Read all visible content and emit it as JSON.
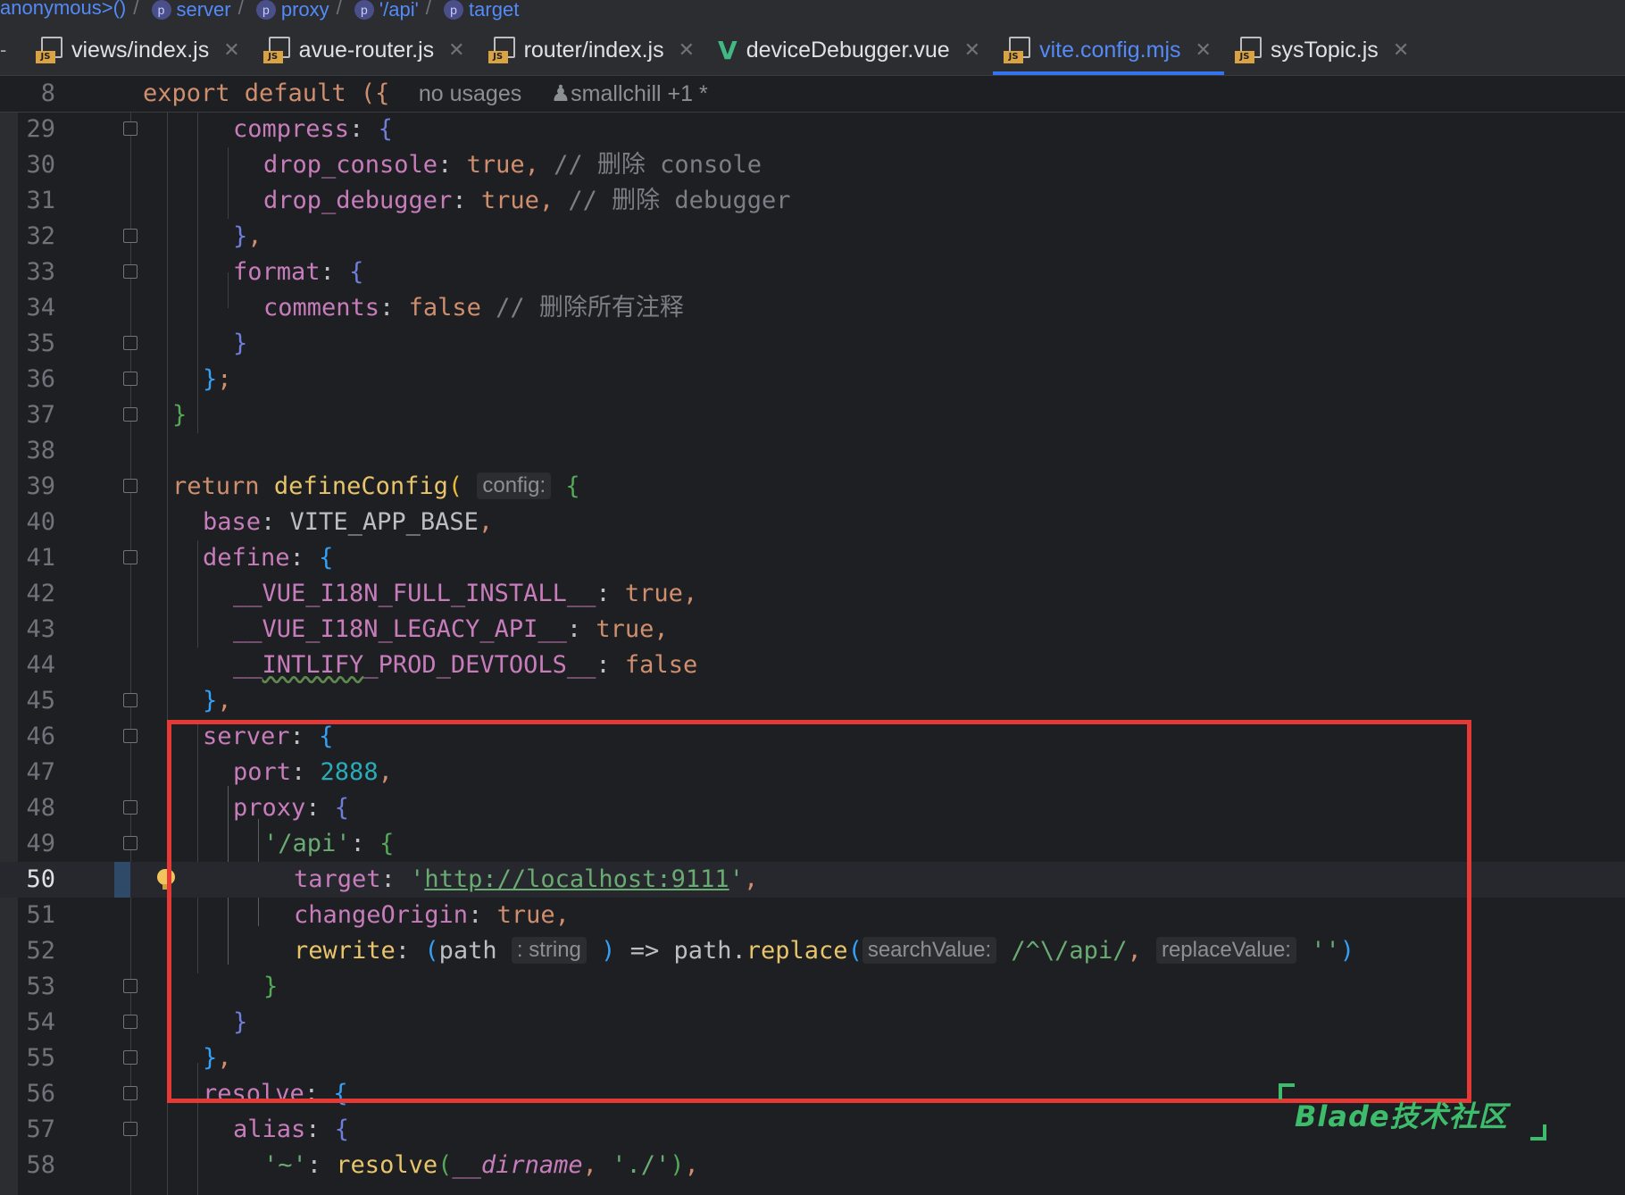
{
  "breadcrumb": [
    {
      "label": "anonymous>()",
      "badge": ""
    },
    {
      "label": "server",
      "badge": "p"
    },
    {
      "label": "proxy",
      "badge": "p"
    },
    {
      "label": "'/api'",
      "badge": "p"
    },
    {
      "label": "target",
      "badge": "p"
    }
  ],
  "tabs": [
    {
      "label": "views/index.js",
      "icon": "js-file-icon",
      "active": false
    },
    {
      "label": "avue-router.js",
      "icon": "js-file-icon",
      "active": false
    },
    {
      "label": "router/index.js",
      "icon": "js-file-icon",
      "active": false
    },
    {
      "label": "deviceDebugger.vue",
      "icon": "vue-file-icon",
      "active": false
    },
    {
      "label": "vite.config.mjs",
      "icon": "js-file-icon",
      "active": true
    },
    {
      "label": "sysTopic.js",
      "icon": "js-file-icon",
      "active": false
    }
  ],
  "tab_close_glyph": "✕",
  "js_badge": "JS",
  "vue_glyph": "V",
  "sticky_header": {
    "line_number": "8",
    "code": "export default ({",
    "usages": "no usages",
    "authors": "smallchill +1 *"
  },
  "current_line": "50",
  "highlight_box_color": "#e53935",
  "watermark": "Blade技术社区",
  "code_lines": [
    {
      "n": "29",
      "fold": true
    },
    {
      "n": "30",
      "fold": false
    },
    {
      "n": "31",
      "fold": false
    },
    {
      "n": "32",
      "fold": true
    },
    {
      "n": "33",
      "fold": true
    },
    {
      "n": "34",
      "fold": false
    },
    {
      "n": "35",
      "fold": true
    },
    {
      "n": "36",
      "fold": true
    },
    {
      "n": "37",
      "fold": true
    },
    {
      "n": "38",
      "fold": false
    },
    {
      "n": "39",
      "fold": true
    },
    {
      "n": "40",
      "fold": false
    },
    {
      "n": "41",
      "fold": true
    },
    {
      "n": "42",
      "fold": false
    },
    {
      "n": "43",
      "fold": false
    },
    {
      "n": "44",
      "fold": false
    },
    {
      "n": "45",
      "fold": true
    },
    {
      "n": "46",
      "fold": true
    },
    {
      "n": "47",
      "fold": false
    },
    {
      "n": "48",
      "fold": true
    },
    {
      "n": "49",
      "fold": true
    },
    {
      "n": "50",
      "fold": false
    },
    {
      "n": "51",
      "fold": false
    },
    {
      "n": "52",
      "fold": false
    },
    {
      "n": "53",
      "fold": true
    },
    {
      "n": "54",
      "fold": true
    },
    {
      "n": "55",
      "fold": true
    },
    {
      "n": "56",
      "fold": true
    },
    {
      "n": "57",
      "fold": true
    },
    {
      "n": "58",
      "fold": false
    }
  ],
  "code": {
    "l29": {
      "key": "compress",
      "colon": ": ",
      "brace": "{"
    },
    "l30": {
      "key": "drop_console",
      "colon": ": ",
      "val": "true",
      "comma": ",",
      "comment": "// 删除 console"
    },
    "l31": {
      "key": "drop_debugger",
      "colon": ": ",
      "val": "true",
      "comma": ",",
      "comment": "// 删除 debugger"
    },
    "l32": {
      "brace": "}",
      "comma": ","
    },
    "l33": {
      "key": "format",
      "colon": ": ",
      "brace": "{"
    },
    "l34": {
      "key": "comments",
      "colon": ": ",
      "val": "false",
      "comment": "// 删除所有注释"
    },
    "l35": {
      "brace": "}"
    },
    "l36": {
      "brace": "}",
      "semi": ";"
    },
    "l37": {
      "brace": "}"
    },
    "l39": {
      "kw": "return",
      "fn": "defineConfig",
      "paren": "(",
      "hint": "config:",
      "brace": "{"
    },
    "l40": {
      "key": "base",
      "colon": ": ",
      "val": "VITE_APP_BASE",
      "comma": ","
    },
    "l41": {
      "key": "define",
      "colon": ": ",
      "brace": "{"
    },
    "l42": {
      "key": "__VUE_I18N_FULL_INSTALL__",
      "colon": ": ",
      "val": "true",
      "comma": ","
    },
    "l43": {
      "key": "__VUE_I18N_LEGACY_API__",
      "colon": ": ",
      "val": "true",
      "comma": ","
    },
    "l44": {
      "key_pre": "__",
      "key_wavy": "INTLIFY",
      "key_post": "_PROD_DEVTOOLS__",
      "colon": ": ",
      "val": "false"
    },
    "l45": {
      "brace": "}",
      "comma": ","
    },
    "l46": {
      "key": "server",
      "colon": ": ",
      "brace": "{"
    },
    "l47": {
      "key": "port",
      "colon": ": ",
      "val": "2888",
      "comma": ","
    },
    "l48": {
      "key": "proxy",
      "colon": ": ",
      "brace": "{"
    },
    "l49": {
      "key": "'/api'",
      "colon": ": ",
      "brace": "{"
    },
    "l50": {
      "key": "target",
      "colon": ": ",
      "q": "'",
      "url": "http://localhost:9111",
      "comma": ","
    },
    "l51": {
      "key": "changeOrigin",
      "colon": ": ",
      "val": "true",
      "comma": ","
    },
    "l52": {
      "fn": "rewrite",
      "colon": ": ",
      "open": "(",
      "param": "path",
      "typehint": ": string",
      "close": ")",
      "arrow": " => ",
      "obj": "path",
      "dot": ".",
      "method": "replace",
      "paren": "(",
      "hint1": "searchValue:",
      "regex": "/^\\/api/",
      "comma": ", ",
      "hint2": "replaceValue:",
      "empty": "''",
      "cparen": ")"
    },
    "l53": {
      "brace": "}"
    },
    "l54": {
      "brace": "}"
    },
    "l55": {
      "brace": "}",
      "comma": ","
    },
    "l56": {
      "key": "resolve",
      "colon": ": ",
      "brace": "{"
    },
    "l57": {
      "key": "alias",
      "colon": ": ",
      "brace": "{"
    },
    "l58": {
      "key": "'~'",
      "colon": ": ",
      "fn": "resolve",
      "paren": "(",
      "arg1": "__dirname",
      "comma": ", ",
      "arg2": "'./'",
      "cparen": ")",
      "tail": ","
    }
  }
}
